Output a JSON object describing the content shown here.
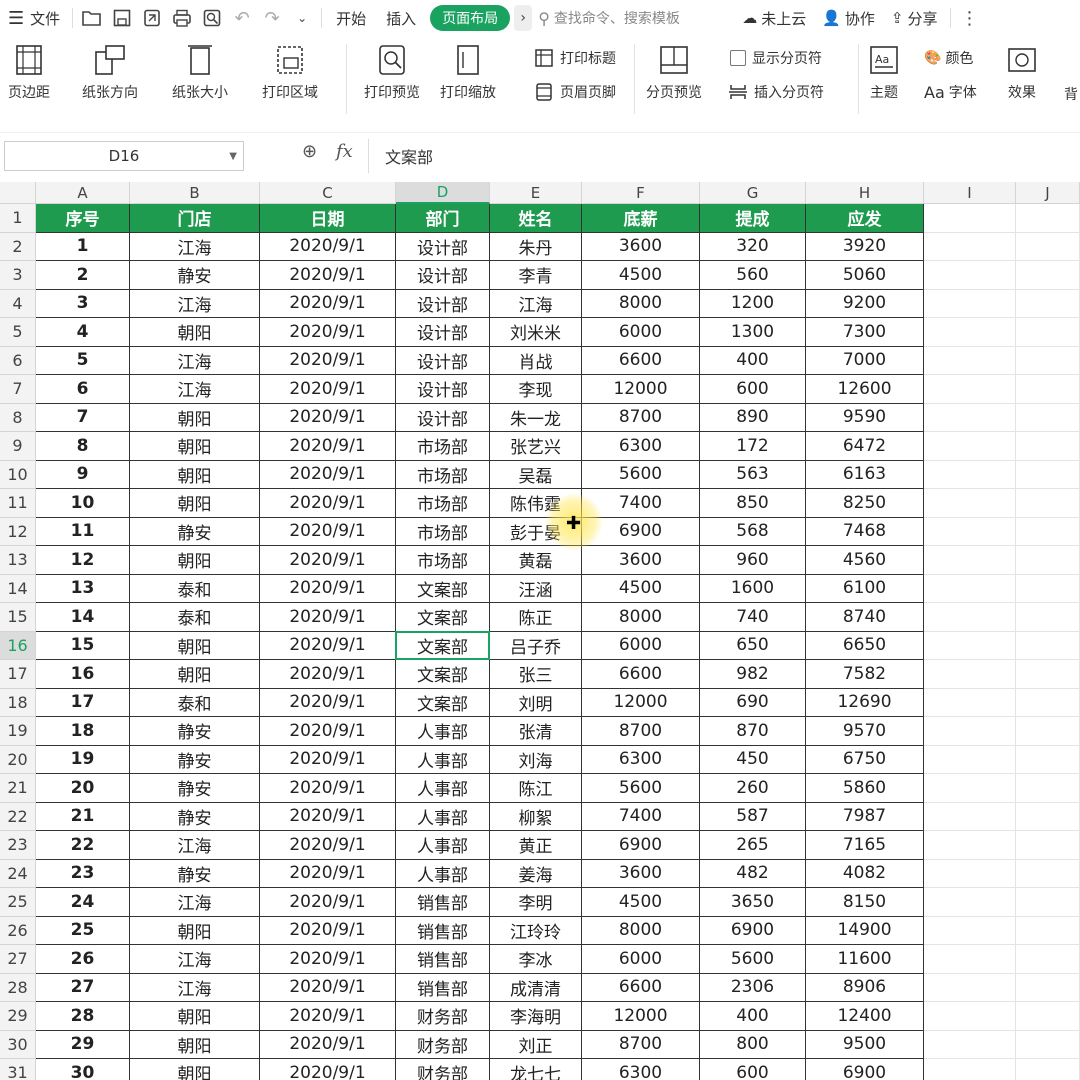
{
  "menubar": {
    "file": "文件",
    "tabs": [
      "开始",
      "插入",
      "页面布局"
    ],
    "search_placeholder": "查找命令、搜索模板",
    "cloud": "未上云",
    "collab": "协作",
    "share": "分享"
  },
  "ribbon": {
    "margins": "页边距",
    "orientation": "纸张方向",
    "size": "纸张大小",
    "print_area": "打印区域",
    "print_preview": "打印预览",
    "print_scale": "打印缩放",
    "print_titles": "打印标题",
    "header_footer": "页眉页脚",
    "page_break_preview": "分页预览",
    "show_page_breaks": "显示分页符",
    "insert_page_break": "插入分页符",
    "theme": "主题",
    "colors": "颜色",
    "fonts": "字体",
    "effects": "效果",
    "background": "背"
  },
  "formula_bar": {
    "name_box": "D16",
    "fx": "fx",
    "value": "文案部"
  },
  "columns": [
    "A",
    "B",
    "C",
    "D",
    "E",
    "F",
    "G",
    "H",
    "I",
    "J"
  ],
  "selected_column": "D",
  "selected_row": 16,
  "headers": [
    "序号",
    "门店",
    "日期",
    "部门",
    "姓名",
    "底薪",
    "提成",
    "应发"
  ],
  "rows": [
    [
      "1",
      "江海",
      "2020/9/1",
      "设计部",
      "朱丹",
      "3600",
      "320",
      "3920"
    ],
    [
      "2",
      "静安",
      "2020/9/1",
      "设计部",
      "李青",
      "4500",
      "560",
      "5060"
    ],
    [
      "3",
      "江海",
      "2020/9/1",
      "设计部",
      "江海",
      "8000",
      "1200",
      "9200"
    ],
    [
      "4",
      "朝阳",
      "2020/9/1",
      "设计部",
      "刘米米",
      "6000",
      "1300",
      "7300"
    ],
    [
      "5",
      "江海",
      "2020/9/1",
      "设计部",
      "肖战",
      "6600",
      "400",
      "7000"
    ],
    [
      "6",
      "江海",
      "2020/9/1",
      "设计部",
      "李现",
      "12000",
      "600",
      "12600"
    ],
    [
      "7",
      "朝阳",
      "2020/9/1",
      "设计部",
      "朱一龙",
      "8700",
      "890",
      "9590"
    ],
    [
      "8",
      "朝阳",
      "2020/9/1",
      "市场部",
      "张艺兴",
      "6300",
      "172",
      "6472"
    ],
    [
      "9",
      "朝阳",
      "2020/9/1",
      "市场部",
      "吴磊",
      "5600",
      "563",
      "6163"
    ],
    [
      "10",
      "朝阳",
      "2020/9/1",
      "市场部",
      "陈伟霆",
      "7400",
      "850",
      "8250"
    ],
    [
      "11",
      "静安",
      "2020/9/1",
      "市场部",
      "彭于晏",
      "6900",
      "568",
      "7468"
    ],
    [
      "12",
      "朝阳",
      "2020/9/1",
      "市场部",
      "黄磊",
      "3600",
      "960",
      "4560"
    ],
    [
      "13",
      "泰和",
      "2020/9/1",
      "文案部",
      "汪涵",
      "4500",
      "1600",
      "6100"
    ],
    [
      "14",
      "泰和",
      "2020/9/1",
      "文案部",
      "陈正",
      "8000",
      "740",
      "8740"
    ],
    [
      "15",
      "朝阳",
      "2020/9/1",
      "文案部",
      "吕子乔",
      "6000",
      "650",
      "6650"
    ],
    [
      "16",
      "朝阳",
      "2020/9/1",
      "文案部",
      "张三",
      "6600",
      "982",
      "7582"
    ],
    [
      "17",
      "泰和",
      "2020/9/1",
      "文案部",
      "刘明",
      "12000",
      "690",
      "12690"
    ],
    [
      "18",
      "静安",
      "2020/9/1",
      "人事部",
      "张清",
      "8700",
      "870",
      "9570"
    ],
    [
      "19",
      "静安",
      "2020/9/1",
      "人事部",
      "刘海",
      "6300",
      "450",
      "6750"
    ],
    [
      "20",
      "静安",
      "2020/9/1",
      "人事部",
      "陈江",
      "5600",
      "260",
      "5860"
    ],
    [
      "21",
      "静安",
      "2020/9/1",
      "人事部",
      "柳絮",
      "7400",
      "587",
      "7987"
    ],
    [
      "22",
      "江海",
      "2020/9/1",
      "人事部",
      "黄正",
      "6900",
      "265",
      "7165"
    ],
    [
      "23",
      "静安",
      "2020/9/1",
      "人事部",
      "姜海",
      "3600",
      "482",
      "4082"
    ],
    [
      "24",
      "江海",
      "2020/9/1",
      "销售部",
      "李明",
      "4500",
      "3650",
      "8150"
    ],
    [
      "25",
      "朝阳",
      "2020/9/1",
      "销售部",
      "江玲玲",
      "8000",
      "6900",
      "14900"
    ],
    [
      "26",
      "江海",
      "2020/9/1",
      "销售部",
      "李冰",
      "6000",
      "5600",
      "11600"
    ],
    [
      "27",
      "江海",
      "2020/9/1",
      "销售部",
      "成清清",
      "6600",
      "2306",
      "8906"
    ],
    [
      "28",
      "朝阳",
      "2020/9/1",
      "财务部",
      "李海明",
      "12000",
      "400",
      "12400"
    ],
    [
      "29",
      "朝阳",
      "2020/9/1",
      "财务部",
      "刘正",
      "8700",
      "800",
      "9500"
    ],
    [
      "30",
      "朝阳",
      "2020/9/1",
      "财务部",
      "龙七七",
      "6300",
      "600",
      "6900"
    ]
  ],
  "colors": {
    "accent": "#1aa260",
    "header_fill": "#1e9b4f"
  }
}
